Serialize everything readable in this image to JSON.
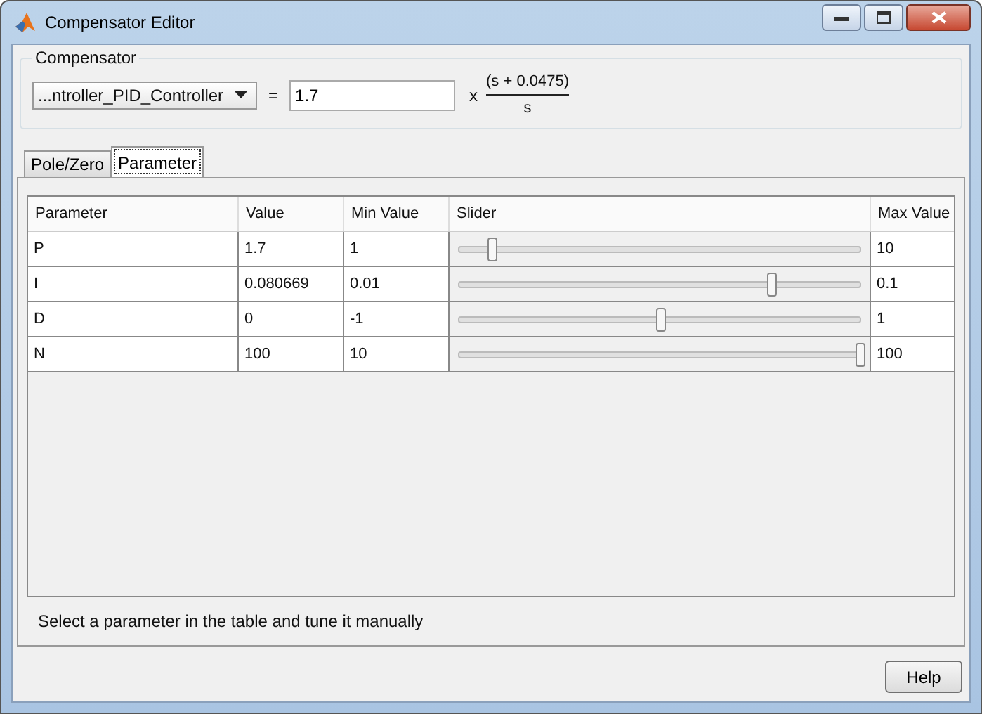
{
  "window": {
    "title": "Compensator Editor"
  },
  "compensator": {
    "label": "Compensator",
    "dropdown": "...ntroller_PID_Controller",
    "equals": "=",
    "gain": "1.7",
    "times": "x",
    "numerator": "(s + 0.0475)",
    "denominator": "s"
  },
  "tabs": [
    {
      "label": "Pole/Zero",
      "selected": false
    },
    {
      "label": "Parameter",
      "selected": true
    }
  ],
  "table": {
    "columns": [
      "Parameter",
      "Value",
      "Min Value",
      "Slider",
      "Max Value"
    ],
    "rows": [
      {
        "name": "P",
        "value": "1.7",
        "min": "1",
        "level": 0.08,
        "max": "10"
      },
      {
        "name": "I",
        "value": "0.080669",
        "min": "0.01",
        "level": 0.78,
        "max": "0.1"
      },
      {
        "name": "D",
        "value": "0",
        "min": "-1",
        "level": 0.5,
        "max": "1"
      },
      {
        "name": "N",
        "value": "100",
        "min": "10",
        "level": 1.0,
        "max": "100"
      }
    ]
  },
  "status": "Select a parameter in the table and tune it manually",
  "buttons": [
    "Help"
  ]
}
